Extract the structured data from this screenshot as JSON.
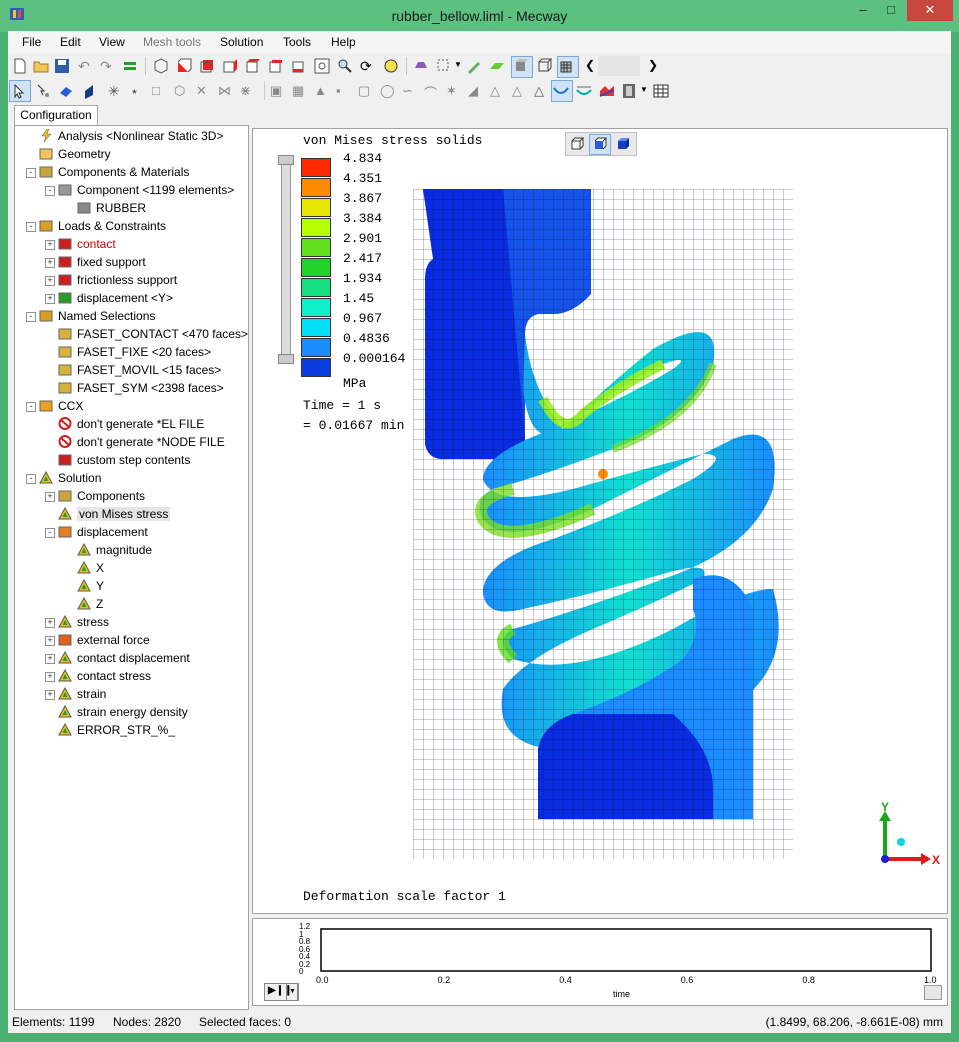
{
  "window": {
    "title": "rubber_bellow.liml - Mecway"
  },
  "menu": [
    "File",
    "Edit",
    "View",
    "Mesh tools",
    "Solution",
    "Tools",
    "Help"
  ],
  "tabs": {
    "configuration": "Configuration"
  },
  "tree": [
    {
      "label": "Analysis <Nonlinear Static 3D>",
      "icon": "analysis-icon"
    },
    {
      "label": "Geometry",
      "icon": "folder-icon"
    },
    {
      "label": "Components & Materials",
      "icon": "components-icon"
    },
    {
      "label": "Component <1199 elements>",
      "icon": "component-icon"
    },
    {
      "label": "RUBBER",
      "icon": "material-icon"
    },
    {
      "label": "Loads & Constraints",
      "icon": "loads-icon"
    },
    {
      "label": "contact",
      "icon": "contact-icon",
      "color": "#cc0000"
    },
    {
      "label": "fixed support",
      "icon": "fixed-support-icon"
    },
    {
      "label": "frictionless support",
      "icon": "frictionless-support-icon"
    },
    {
      "label": "displacement <Y>",
      "icon": "displacement-constraint-icon"
    },
    {
      "label": "Named Selections",
      "icon": "named-selection-icon"
    },
    {
      "label": "FASET_CONTACT <470 faces>",
      "icon": "face-set-icon"
    },
    {
      "label": "FASET_FIXE <20 faces>",
      "icon": "face-set-icon"
    },
    {
      "label": "FASET_MOVIL <15 faces>",
      "icon": "face-set-icon"
    },
    {
      "label": "FASET_SYM <2398 faces>",
      "icon": "face-set-icon"
    },
    {
      "label": "CCX",
      "icon": "ccx-icon"
    },
    {
      "label": "don't generate *EL FILE",
      "icon": "no-icon"
    },
    {
      "label": "don't generate *NODE FILE",
      "icon": "no-icon"
    },
    {
      "label": "custom step contents",
      "icon": "ccx-step-icon"
    },
    {
      "label": "Solution",
      "icon": "solution-icon"
    },
    {
      "label": "Components",
      "icon": "components-icon"
    },
    {
      "label": "von Mises stress",
      "icon": "result-icon"
    },
    {
      "label": "displacement",
      "icon": "displacement-result-icon"
    },
    {
      "label": "magnitude",
      "icon": "result-icon"
    },
    {
      "label": "X",
      "icon": "result-icon"
    },
    {
      "label": "Y",
      "icon": "result-icon"
    },
    {
      "label": "Z",
      "icon": "result-icon"
    },
    {
      "label": "stress",
      "icon": "result-icon"
    },
    {
      "label": "external force",
      "icon": "force-result-icon"
    },
    {
      "label": "contact displacement",
      "icon": "result-icon"
    },
    {
      "label": "contact stress",
      "icon": "result-icon"
    },
    {
      "label": "strain",
      "icon": "result-icon"
    },
    {
      "label": "strain energy density",
      "icon": "result-icon"
    },
    {
      "label": "ERROR_STR_%_",
      "icon": "result-icon"
    }
  ],
  "viewport": {
    "result_title": "von Mises stress solids",
    "legend": {
      "values": [
        "4.834",
        "4.351",
        "3.867",
        "3.384",
        "2.901",
        "2.417",
        "1.934",
        "1.45",
        "0.967",
        "0.4836",
        "0.000164"
      ],
      "colors": [
        "#ff2a00",
        "#ff8c00",
        "#e6e600",
        "#b4ff00",
        "#62e01c",
        "#22d42a",
        "#14e080",
        "#10f0c8",
        "#00e0f8",
        "#1a8cff",
        "#0a3ce0"
      ],
      "unit": "MPa"
    },
    "time_line1": "Time = 1 s",
    "time_line2": "= 0.01667 min",
    "deformation": "Deformation scale factor 1",
    "axes": {
      "x": "X",
      "y": "Y"
    }
  },
  "time_plot": {
    "y_ticks": [
      "1.2",
      "1",
      "0.8",
      "0.6",
      "0.4",
      "0.2",
      "0"
    ],
    "x_ticks": [
      "0.0",
      "0.2",
      "0.4",
      "0.6",
      "0.8",
      "1.0"
    ],
    "x_label": "time"
  },
  "status": {
    "elements": "Elements: 1199",
    "nodes": "Nodes: 2820",
    "selected": "Selected faces: 0",
    "coords": "(1.8499, 68.206, -8.661E-08) mm"
  }
}
